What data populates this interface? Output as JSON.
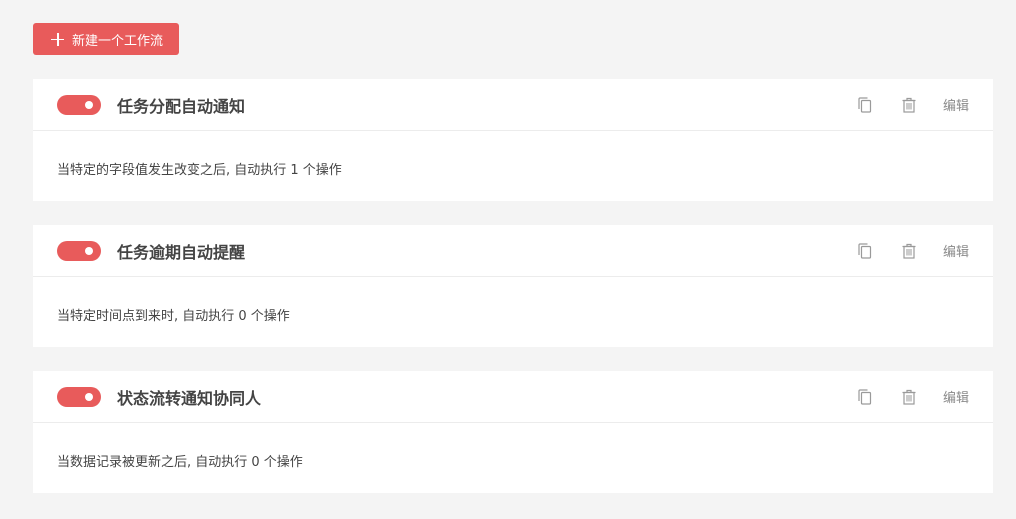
{
  "toolbar": {
    "new_workflow_label": "新建一个工作流"
  },
  "colors": {
    "accent": "#e85b5b",
    "background": "#f4f4f4",
    "icon": "#9a9a9a"
  },
  "workflows": [
    {
      "enabled": true,
      "title": "任务分配自动通知",
      "description": "当特定的字段值发生改变之后, 自动执行 1 个操作",
      "copy_icon": "copy-icon",
      "delete_icon": "trash-icon",
      "edit_label": "编辑"
    },
    {
      "enabled": true,
      "title": "任务逾期自动提醒",
      "description": "当特定时间点到来时, 自动执行 0 个操作",
      "copy_icon": "copy-icon",
      "delete_icon": "trash-icon",
      "edit_label": "编辑"
    },
    {
      "enabled": true,
      "title": "状态流转通知协同人",
      "description": "当数据记录被更新之后, 自动执行 0 个操作",
      "copy_icon": "copy-icon",
      "delete_icon": "trash-icon",
      "edit_label": "编辑"
    }
  ]
}
